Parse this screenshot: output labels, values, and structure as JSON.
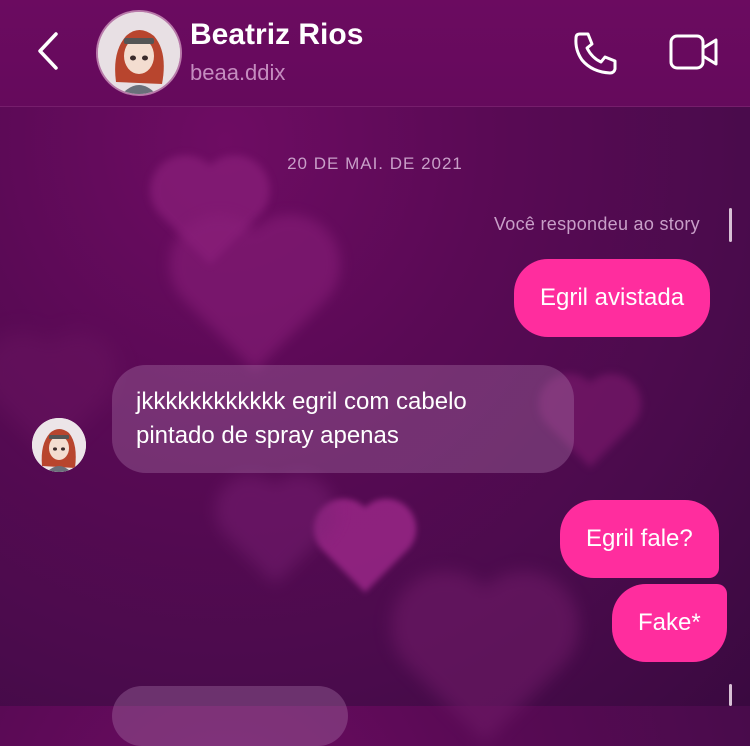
{
  "header": {
    "title": "Beatriz Rios",
    "username": "beaa.ddix",
    "icons": [
      "back-chevron-icon",
      "phone-icon",
      "video-camera-icon"
    ]
  },
  "thread": {
    "date": "20 DE MAI. DE 2021",
    "story_reply_label": "Você respondeu ao story",
    "messages": [
      {
        "from": "me",
        "text": "Egril avistada"
      },
      {
        "from": "them",
        "text_lines": [
          "jkkkkkkkkkkkk egril com cabelo",
          "pintado de spray apenas"
        ]
      },
      {
        "from": "me",
        "text": "Egril fale?"
      },
      {
        "from": "me",
        "text": "Fake*"
      }
    ]
  },
  "colors": {
    "outgoing_bubble": "#ff2d9e",
    "incoming_bubble": "#7a4a7a",
    "background": "#5a0a55"
  }
}
